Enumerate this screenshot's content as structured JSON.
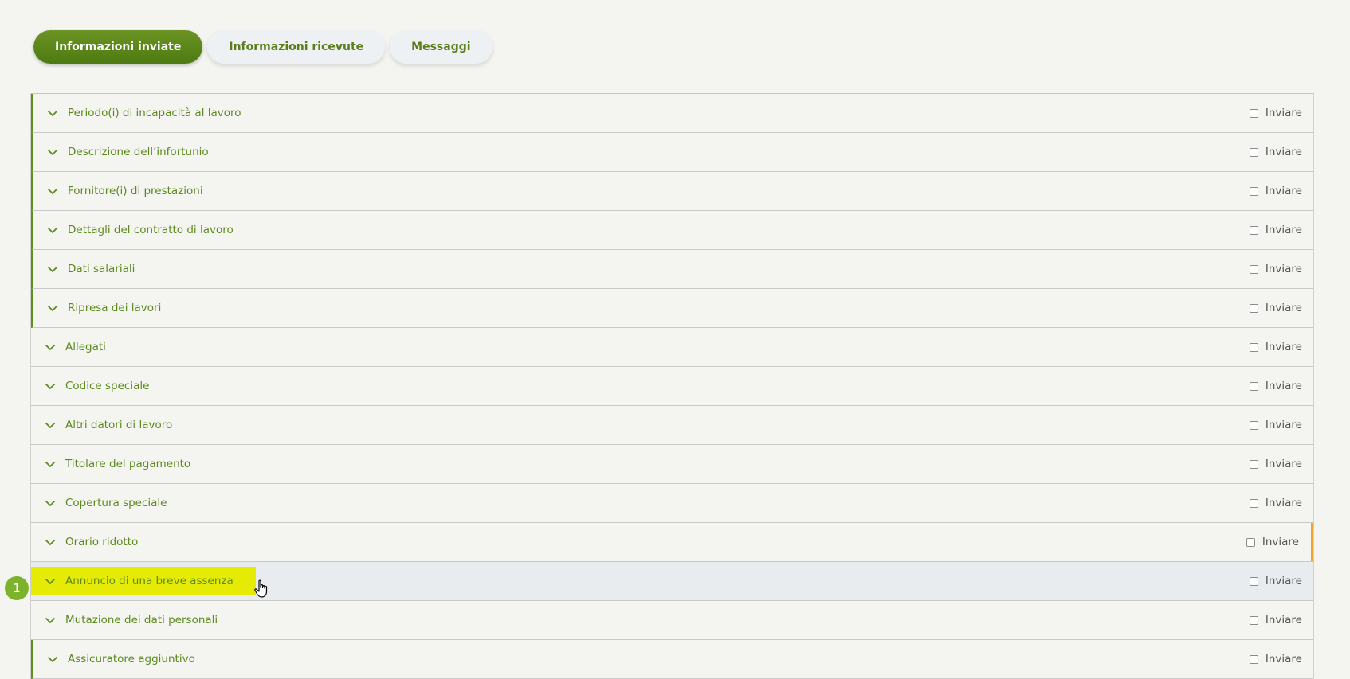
{
  "tabs": [
    {
      "label": "Informazioni inviate",
      "active": true
    },
    {
      "label": "Informazioni ricevute",
      "active": false
    },
    {
      "label": "Messaggi",
      "active": false
    }
  ],
  "rows": [
    {
      "label": "Periodo(i) di incapacità al lavoro",
      "send_label": "Inviare"
    },
    {
      "label": "Descrizione dell’infortunio",
      "send_label": "Inviare"
    },
    {
      "label": "Fornitore(i) di prestazioni",
      "send_label": "Inviare"
    },
    {
      "label": "Dettagli del contratto di lavoro",
      "send_label": "Inviare"
    },
    {
      "label": "Dati salariali",
      "send_label": "Inviare"
    },
    {
      "label": "Ripresa dei lavori",
      "send_label": "Inviare"
    },
    {
      "label": "Allegati",
      "send_label": "Inviare"
    },
    {
      "label": "Codice speciale",
      "send_label": "Inviare"
    },
    {
      "label": "Altri datori di lavoro",
      "send_label": "Inviare"
    },
    {
      "label": "Titolare del pagamento",
      "send_label": "Inviare"
    },
    {
      "label": "Copertura speciale",
      "send_label": "Inviare"
    },
    {
      "label": "Orario ridotto",
      "send_label": "Inviare"
    },
    {
      "label": "Annuncio di una breve assenza",
      "send_label": "Inviare"
    },
    {
      "label": "Mutazione dei dati personali",
      "send_label": "Inviare"
    },
    {
      "label": "Assicuratore aggiuntivo",
      "send_label": "Inviare"
    }
  ],
  "step_badge": "1",
  "colors": {
    "brand_green": "#5c8a1e",
    "highlight": "#e6eb06",
    "warning": "#efa52a"
  },
  "icons": {
    "row_toggle": "chevron-down-icon",
    "pointer": "hand-cursor-icon"
  }
}
